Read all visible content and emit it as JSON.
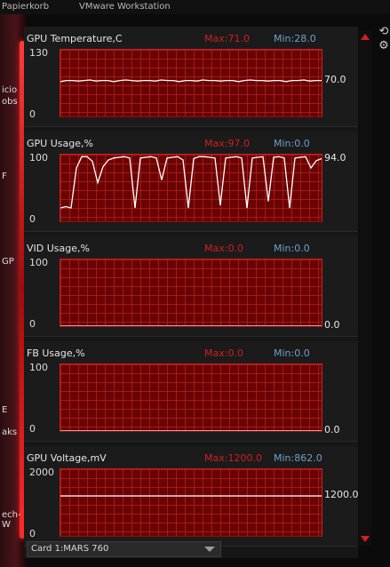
{
  "desktop": {
    "top_labels": [
      "Papierkorb",
      "VMware Workstation"
    ],
    "left_fragments": [
      "icio",
      "obs",
      "F",
      "GP",
      "E",
      "aks",
      "ech-W"
    ]
  },
  "footer": {
    "card_select_value": "Card 1:MARS 760"
  },
  "panels": [
    {
      "title": "GPU Temperature,C",
      "max_label": "Max:71.0",
      "min_label": "Min:28.0",
      "y_top": "130",
      "y_bottom": "0",
      "current": "70.0"
    },
    {
      "title": "GPU Usage,%",
      "max_label": "Max:97.0",
      "min_label": "Min:0.0",
      "y_top": "100",
      "y_bottom": "0",
      "current": "94.0"
    },
    {
      "title": "VID Usage,%",
      "max_label": "Max:0.0",
      "min_label": "Min:0.0",
      "y_top": "100",
      "y_bottom": "0",
      "current": "0.0"
    },
    {
      "title": "FB Usage,%",
      "max_label": "Max:0.0",
      "min_label": "Min:0.0",
      "y_top": "100",
      "y_bottom": "0",
      "current": "0.0"
    },
    {
      "title": "GPU Voltage,mV",
      "max_label": "Max:1200.0",
      "min_label": "Min:862.0",
      "y_top": "2000",
      "y_bottom": "0",
      "current": "1200.0"
    }
  ],
  "chart_data": [
    {
      "type": "line",
      "title": "GPU Temperature,C",
      "ylim": [
        0,
        130
      ],
      "series": [
        {
          "values": [
            68,
            70,
            70,
            69,
            70,
            71,
            69,
            70,
            70,
            68,
            70,
            71,
            70,
            69,
            70,
            70,
            69,
            71,
            70,
            70,
            68,
            70,
            70,
            69,
            71,
            70,
            70,
            69,
            70,
            70,
            68,
            70,
            71,
            70,
            70,
            69,
            70,
            70,
            68,
            70,
            70,
            71,
            69,
            70,
            70
          ]
        }
      ]
    },
    {
      "type": "line",
      "title": "GPU Usage,%",
      "ylim": [
        0,
        100
      ],
      "series": [
        {
          "values": [
            20,
            22,
            20,
            80,
            97,
            97,
            90,
            58,
            82,
            92,
            95,
            96,
            97,
            95,
            20,
            95,
            96,
            97,
            95,
            62,
            95,
            96,
            97,
            92,
            20,
            94,
            97,
            97,
            96,
            95,
            24,
            95,
            96,
            97,
            95,
            20,
            95,
            96,
            97,
            30,
            96,
            97,
            95,
            20,
            95,
            96,
            97,
            80,
            91,
            94
          ]
        }
      ]
    },
    {
      "type": "line",
      "title": "VID Usage,%",
      "ylim": [
        0,
        100
      ],
      "series": [
        {
          "values": [
            0,
            0,
            0,
            0,
            0,
            0,
            0,
            0,
            0,
            0,
            0,
            0,
            0,
            0,
            0,
            0,
            0,
            0,
            0,
            0
          ]
        }
      ]
    },
    {
      "type": "line",
      "title": "FB Usage,%",
      "ylim": [
        0,
        100
      ],
      "series": [
        {
          "values": [
            0,
            0,
            0,
            0,
            0,
            0,
            0,
            0,
            0,
            0,
            0,
            0,
            0,
            0,
            0,
            0,
            0,
            0,
            0,
            0
          ]
        }
      ]
    },
    {
      "type": "line",
      "title": "GPU Voltage,mV",
      "ylim": [
        0,
        2000
      ],
      "series": [
        {
          "values": [
            1200,
            1200,
            1200,
            1200,
            1200,
            1200,
            1200,
            1200,
            1200,
            1200,
            1200,
            1200,
            1200,
            1200,
            1200,
            1200,
            1200,
            1200,
            1200,
            1200
          ]
        }
      ]
    }
  ]
}
